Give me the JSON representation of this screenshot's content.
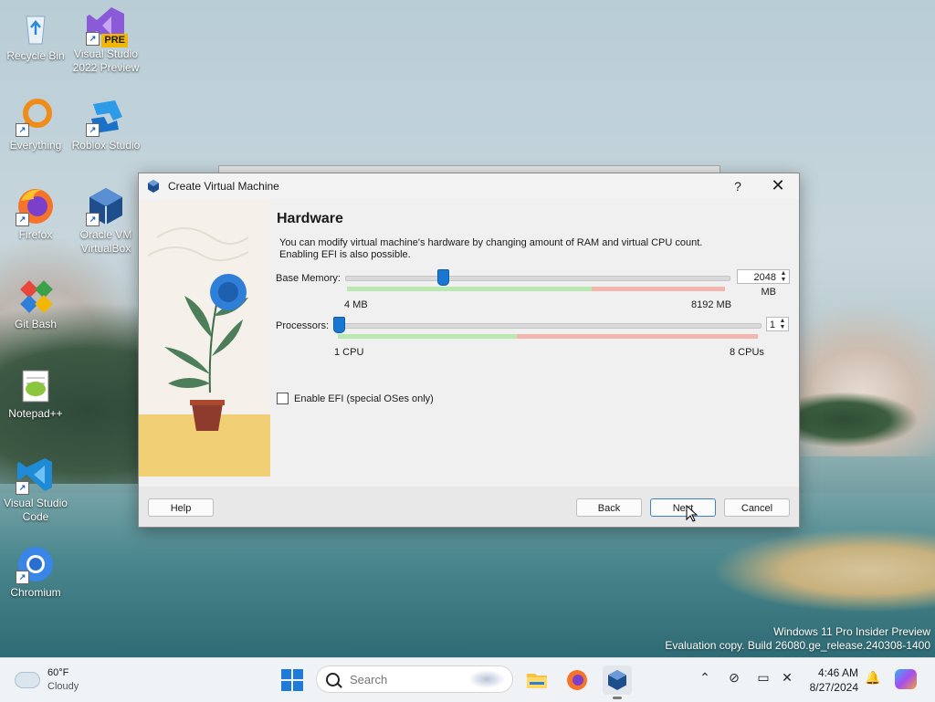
{
  "desktop": {
    "icons": [
      {
        "label": "Recycle Bin",
        "icon": "recycle-bin-icon"
      },
      {
        "label": "Visual Studio 2022 Preview",
        "icon": "visual-studio-icon",
        "badge": "PRE"
      },
      {
        "label": "Everything",
        "icon": "everything-search-icon"
      },
      {
        "label": "Roblox Studio",
        "icon": "roblox-studio-icon"
      },
      {
        "label": "Firefox",
        "icon": "firefox-icon"
      },
      {
        "label": "Oracle VM VirtualBox",
        "icon": "virtualbox-icon"
      },
      {
        "label": "Git Bash",
        "icon": "git-bash-icon"
      },
      {
        "label": "Notepad++",
        "icon": "notepad-plus-plus-icon"
      },
      {
        "label": "Visual Studio Code",
        "icon": "vscode-icon"
      },
      {
        "label": "Chromium",
        "icon": "chromium-icon"
      }
    ],
    "watermark": {
      "line1": "Windows 11 Pro Insider Preview",
      "line2": "Evaluation copy. Build 26080.ge_release.240308-1400"
    }
  },
  "dialog": {
    "title": "Create Virtual Machine",
    "help_glyph": "?",
    "close_glyph": "✕",
    "heading": "Hardware",
    "description": "You can modify virtual machine's hardware by changing amount of RAM and virtual CPU count. Enabling EFI is also possible.",
    "memory": {
      "label": "Base Memory:",
      "value": "2048 MB",
      "min_label": "4 MB",
      "max_label": "8192 MB",
      "value_fraction": 0.25
    },
    "processors": {
      "label": "Processors:",
      "value": "1",
      "min_label": "1 CPU",
      "max_label": "8 CPUs",
      "value_fraction": 0.0
    },
    "efi": {
      "label": "Enable EFI (special OSes only)",
      "checked": false
    },
    "buttons": {
      "help": "Help",
      "back": "Back",
      "next": "Next",
      "cancel": "Cancel"
    }
  },
  "taskbar": {
    "weather": {
      "temp": "60°F",
      "condition": "Cloudy"
    },
    "search_placeholder": "Search",
    "apps": [
      "file-explorer-icon",
      "firefox-icon",
      "virtualbox-icon"
    ],
    "clock": {
      "time": "4:46 AM",
      "date": "8/27/2024"
    }
  },
  "colors": {
    "accent": "#1877d3",
    "green_zone": "#b9e8b0",
    "red_zone": "#f3b6ae"
  }
}
